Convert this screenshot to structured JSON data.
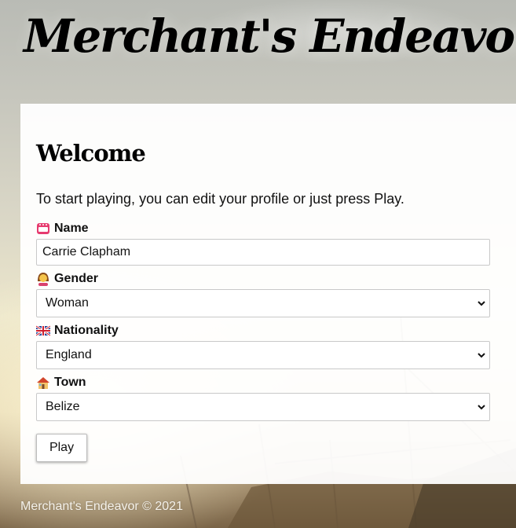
{
  "header": {
    "title": "Merchant's Endeavor"
  },
  "panel": {
    "heading": "Welcome",
    "intro": "To start playing, you can edit your profile or just press Play.",
    "fields": {
      "name": {
        "icon": "name-badge-icon",
        "label": "Name",
        "value": "Carrie Clapham"
      },
      "gender": {
        "icon": "woman-icon",
        "label": "Gender",
        "value": "Woman"
      },
      "nationality": {
        "icon": "uk-flag-icon",
        "label": "Nationality",
        "value": "England"
      },
      "town": {
        "icon": "house-icon",
        "label": "Town",
        "value": "Belize"
      }
    },
    "play_label": "Play"
  },
  "footer": {
    "text": "Merchant's Endeavor © 2021"
  },
  "colors": {
    "panel_bg": "#ffffff",
    "icon_badge": "#e63b6f",
    "flag_blue": "#1c3f94",
    "flag_red": "#cf1f2e"
  }
}
